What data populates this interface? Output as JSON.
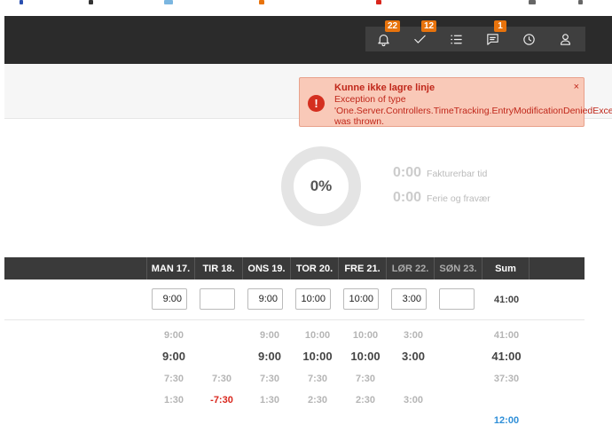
{
  "navbar": {
    "badges": {
      "notifications": "22",
      "tasks": "12",
      "messages": "1"
    }
  },
  "toast": {
    "title": "Kunne ikke lagre linje",
    "message": "Exception of type 'One.Server.Controllers.TimeTracking.EntryModificationDeniedException' was thrown.",
    "close": "×",
    "icon": "!"
  },
  "summary": {
    "percent": "0%",
    "billable_value": "0:00",
    "billable_label": "Fakturerbar tid",
    "absence_value": "0:00",
    "absence_label": "Ferie og fravær"
  },
  "table": {
    "headers": [
      "MAN 17.",
      "TIR 18.",
      "ONS 19.",
      "TOR 20.",
      "FRE 21.",
      "LØR 22.",
      "SØN 23.",
      "Sum"
    ],
    "inputs": [
      "9:00",
      "",
      "9:00",
      "10:00",
      "10:00",
      "3:00",
      ""
    ],
    "input_sum": "41:00",
    "rows": [
      [
        "9:00",
        "",
        "9:00",
        "10:00",
        "10:00",
        "3:00",
        "",
        "41:00"
      ],
      [
        "9:00",
        "",
        "9:00",
        "10:00",
        "10:00",
        "3:00",
        "",
        "41:00"
      ],
      [
        "7:30",
        "7:30",
        "7:30",
        "7:30",
        "7:30",
        "",
        "",
        "37:30"
      ],
      [
        "1:30",
        "-7:30",
        "1:30",
        "2:30",
        "2:30",
        "3:00",
        "",
        ""
      ],
      [
        "",
        "",
        "",
        "",
        "",
        "",
        "",
        "12:00"
      ]
    ]
  },
  "colors": {
    "accent": "#e8730c",
    "navbar": "#2b2b2b",
    "error": "#c0271a",
    "negative": "#d9261c",
    "link": "#2f8fd8"
  }
}
